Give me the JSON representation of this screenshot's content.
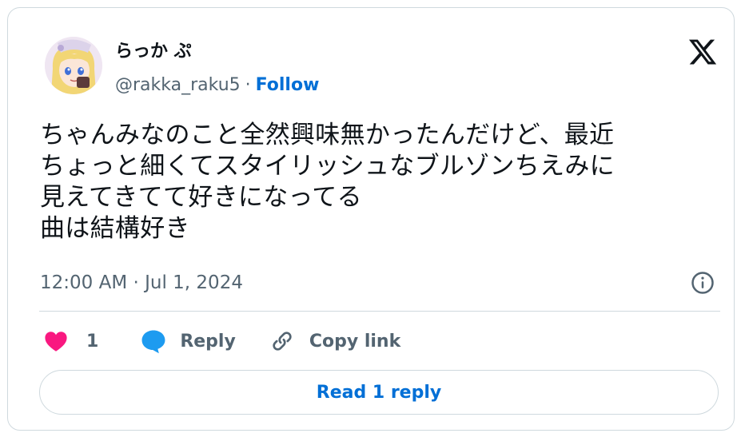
{
  "user": {
    "display_name": "らっか ぷ",
    "handle": "@rakka_raku5",
    "separator": "·",
    "follow_label": "Follow"
  },
  "tweet": {
    "lines": [
      "ちゃんみなのこと全然興味無かったんだけど、最近",
      "ちょっと細くてスタイリッシュなブルゾンちえみに",
      "見えてきてて好きになってる",
      "曲は結構好き"
    ],
    "timestamp": "12:00 AM · Jul 1, 2024"
  },
  "actions": {
    "like_count": "1",
    "reply_label": "Reply",
    "copy_link_label": "Copy link"
  },
  "footer": {
    "read_replies_label": "Read 1 reply"
  },
  "colors": {
    "like": "#f91880",
    "reply": "#1d9bf0",
    "link": "#006fd6",
    "muted": "#536471",
    "border": "#cfd9de"
  },
  "icons": {
    "brand": "x-logo-icon",
    "info": "info-icon",
    "like": "heart-icon",
    "reply": "speech-bubble-icon",
    "copy_link": "link-icon"
  }
}
